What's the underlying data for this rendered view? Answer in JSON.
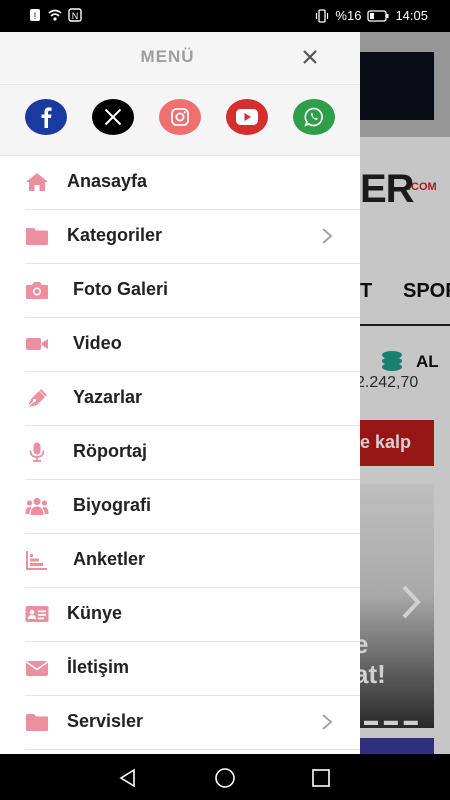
{
  "status": {
    "battery_text": "%16",
    "time": "14:05"
  },
  "background": {
    "logo_text": "ER",
    "logo_suffix": ".COM",
    "nav_1": "T",
    "nav_2": "SPOR",
    "price_label": "AL",
    "price_value": "2.242,70",
    "red_button_text": "e kalp",
    "headline_line1": "e",
    "headline_line2": "at!",
    "slider_dots": "▬ ▬ ▬ ▬"
  },
  "drawer": {
    "title": "MENÜ",
    "close_glyph": "×",
    "social": [
      {
        "name": "facebook",
        "color": "#1a3aa0"
      },
      {
        "name": "x",
        "color": "#000000"
      },
      {
        "name": "instagram",
        "color": "#f07070"
      },
      {
        "name": "youtube",
        "color": "#d32f2f"
      },
      {
        "name": "whatsapp",
        "color": "#2e9e4a"
      }
    ],
    "items": [
      {
        "label": "Anasayfa",
        "icon": "home-icon",
        "arrow": false
      },
      {
        "label": "Kategoriler",
        "icon": "folder-icon",
        "arrow": true
      },
      {
        "label": "Foto Galeri",
        "icon": "camera-icon",
        "arrow": false
      },
      {
        "label": "Video",
        "icon": "video-icon",
        "arrow": false
      },
      {
        "label": "Yazarlar",
        "icon": "pen-icon",
        "arrow": false
      },
      {
        "label": "Röportaj",
        "icon": "microphone-icon",
        "arrow": false
      },
      {
        "label": "Biyografi",
        "icon": "users-icon",
        "arrow": false
      },
      {
        "label": "Anketler",
        "icon": "chart-icon",
        "arrow": false
      },
      {
        "label": "Künye",
        "icon": "id-card-icon",
        "arrow": false
      },
      {
        "label": "İletişim",
        "icon": "envelope-icon",
        "arrow": false
      },
      {
        "label": "Servisler",
        "icon": "folder-icon",
        "arrow": true
      }
    ],
    "icon_color": "#ec8fa1"
  }
}
